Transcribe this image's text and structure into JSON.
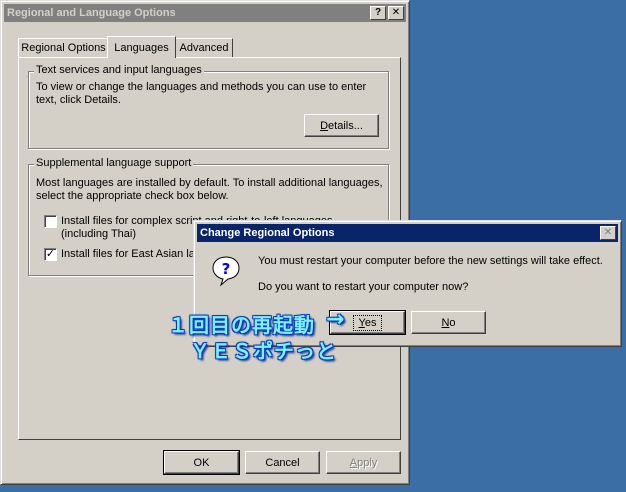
{
  "main_dialog": {
    "title": "Regional and Language Options",
    "help_button": "?",
    "close_button": "✕",
    "tabs": [
      "Regional Options",
      "Languages",
      "Advanced"
    ],
    "text_services": {
      "legend": "Text services and input languages",
      "description_line1": "To view or change the languages and methods you can use to enter",
      "description_line2": "text, click Details.",
      "details_button_pre": "",
      "details_button_ul": "D",
      "details_button_post": "etails..."
    },
    "supplemental": {
      "legend": "Supplemental language support",
      "description_line1": "Most languages are installed by default. To install additional languages,",
      "description_line2": "select the appropriate check box below.",
      "checkbox1_line1": "Install files for complex script and right-to-left languages",
      "checkbox1_line2": "(including Thai)",
      "checkbox1_checked": false,
      "checkbox2_label": "Install files for East Asian lar",
      "checkbox2_checked": true
    },
    "ok_label": "OK",
    "cancel_label": "Cancel",
    "apply_pre": "",
    "apply_ul": "A",
    "apply_post": "pply"
  },
  "restart_dialog": {
    "title": "Change Regional Options",
    "close_button": "✕",
    "icon": "question-icon",
    "message_line1": "You must restart your computer before the new settings will take effect.",
    "message_line2": "Do you want to restart your computer now?",
    "yes_ul": "Y",
    "yes_post": "es",
    "no_ul": "N",
    "no_post": "o"
  },
  "annotation": {
    "line1": "１回目の再起動",
    "line2": "ＹＥＳポチっと",
    "arrow": "→"
  },
  "colors": {
    "desktop": "#3a6ea5",
    "active_title": "#0a246a",
    "inactive_title": "#808080",
    "annotation": "#7ff0ff"
  }
}
